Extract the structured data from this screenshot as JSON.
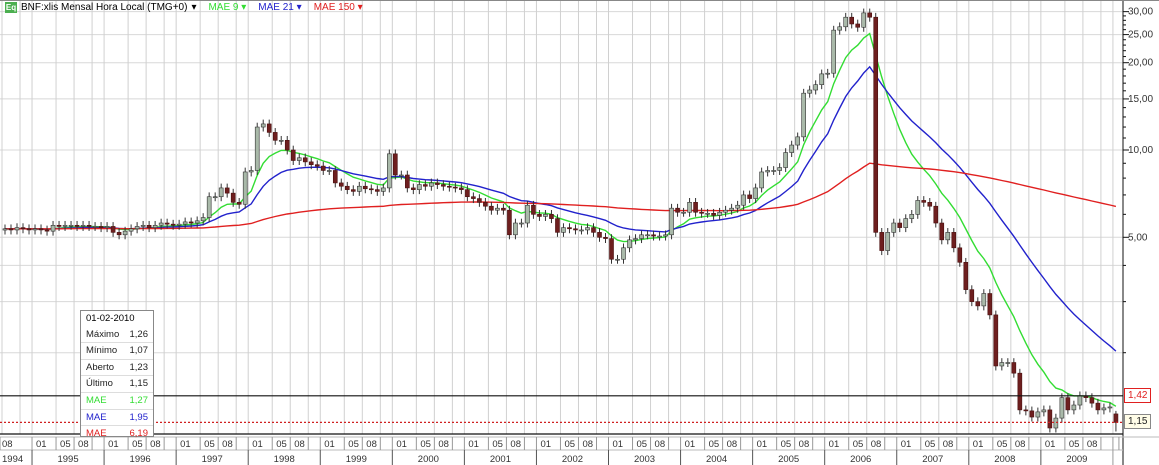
{
  "header": {
    "icon": "Eq",
    "title": "BNF:xlis Mensal Hora Local (TMG+0)",
    "legend": [
      {
        "label": "MAE 9",
        "color": "#33dd33"
      },
      {
        "label": "MAE 21",
        "color": "#2222cc"
      },
      {
        "label": "MAE 150",
        "color": "#e02020"
      }
    ]
  },
  "tooltip": {
    "date": "01-02-2010",
    "rows": [
      {
        "label": "Máximo",
        "value": "1,26",
        "color": "#222"
      },
      {
        "label": "Mínimo",
        "value": "1,07",
        "color": "#222"
      },
      {
        "label": "Aberto",
        "value": "1,23",
        "color": "#222"
      },
      {
        "label": "Último",
        "value": "1,15",
        "color": "#222"
      },
      {
        "label": "MAE",
        "value": "1,27",
        "color": "#33dd33"
      },
      {
        "label": "MAE",
        "value": "1,95",
        "color": "#2222cc"
      },
      {
        "label": "MAE",
        "value": "6,19",
        "color": "#e02020"
      }
    ]
  },
  "price_markers": [
    {
      "label": "1,42",
      "value": 1.42,
      "style": "solid",
      "color": "#e02020",
      "bg": "#fff"
    },
    {
      "label": "1,15",
      "value": 1.15,
      "style": "dotted",
      "color": "#222",
      "bg": "#fffde8"
    }
  ],
  "chart_data": {
    "type": "candlestick",
    "scale": "log",
    "start_month": "1994-08",
    "frequency": "monthly",
    "y_ticks": [
      {
        "v": 30,
        "label": "30,00"
      },
      {
        "v": 25,
        "label": "25,00"
      },
      {
        "v": 20,
        "label": "20,00"
      },
      {
        "v": 15,
        "label": "15,00"
      },
      {
        "v": 10,
        "label": "10,00"
      },
      {
        "v": 5,
        "label": "5,00"
      }
    ],
    "month_labels": [
      "01",
      "05",
      "08"
    ],
    "first_year": "1994",
    "years": [
      "1995",
      "1996",
      "1997",
      "1998",
      "1999",
      "2000",
      "2001",
      "2002",
      "2003",
      "2004",
      "2005",
      "2006",
      "2007",
      "2008",
      "2009"
    ],
    "last_bar": {
      "open": 1.23,
      "high": 1.26,
      "low": 1.07,
      "close": 1.15
    },
    "ema_periods": [
      9,
      21,
      150
    ],
    "closes": [
      5.35,
      5.3,
      5.4,
      5.35,
      5.3,
      5.35,
      5.3,
      5.25,
      5.5,
      5.45,
      5.5,
      5.5,
      5.45,
      5.5,
      5.45,
      5.45,
      5.4,
      5.45,
      5.2,
      5.1,
      5.25,
      5.35,
      5.45,
      5.5,
      5.4,
      5.5,
      5.6,
      5.55,
      5.5,
      5.55,
      5.65,
      5.6,
      5.7,
      5.85,
      6.9,
      6.9,
      7.4,
      7.1,
      6.6,
      6.5,
      8.4,
      8.5,
      12.0,
      12.3,
      11.5,
      10.8,
      10.8,
      10.0,
      9.2,
      9.4,
      9.1,
      8.9,
      8.8,
      8.5,
      8.5,
      7.7,
      7.5,
      7.3,
      7.2,
      7.5,
      7.35,
      7.3,
      7.2,
      7.4,
      9.7,
      8.2,
      8.2,
      7.4,
      7.3,
      7.6,
      7.5,
      7.7,
      7.6,
      7.5,
      7.45,
      7.4,
      7.3,
      6.9,
      6.8,
      6.6,
      6.4,
      6.2,
      6.3,
      6.2,
      5.1,
      5.6,
      5.6,
      6.45,
      6.0,
      5.9,
      6.0,
      5.8,
      5.2,
      5.4,
      5.35,
      5.3,
      5.3,
      5.4,
      5.2,
      5.0,
      4.95,
      4.2,
      4.2,
      4.6,
      4.9,
      4.95,
      5.1,
      5.1,
      5.05,
      5.05,
      5.1,
      6.3,
      6.1,
      6.1,
      6.6,
      6.1,
      6.05,
      6.05,
      5.95,
      6.1,
      6.2,
      6.3,
      6.45,
      7.0,
      6.8,
      7.4,
      8.4,
      8.5,
      8.5,
      8.7,
      9.8,
      10.4,
      11.1,
      15.7,
      16.1,
      16.8,
      18.3,
      18.4,
      25.9,
      26.6,
      28.7,
      27.2,
      26.5,
      29.7,
      28.7,
      5.2,
      4.5,
      5.2,
      5.6,
      5.4,
      5.8,
      6.0,
      6.7,
      6.6,
      6.4,
      5.6,
      4.9,
      5.2,
      4.6,
      4.1,
      3.3,
      3.0,
      2.9,
      3.2,
      2.7,
      1.8,
      1.85,
      1.85,
      1.7,
      1.27,
      1.26,
      1.2,
      1.25,
      1.27,
      1.1,
      1.19,
      1.4,
      1.27,
      1.32,
      1.42,
      1.4,
      1.34,
      1.27,
      1.29,
      1.3,
      1.15
    ]
  }
}
